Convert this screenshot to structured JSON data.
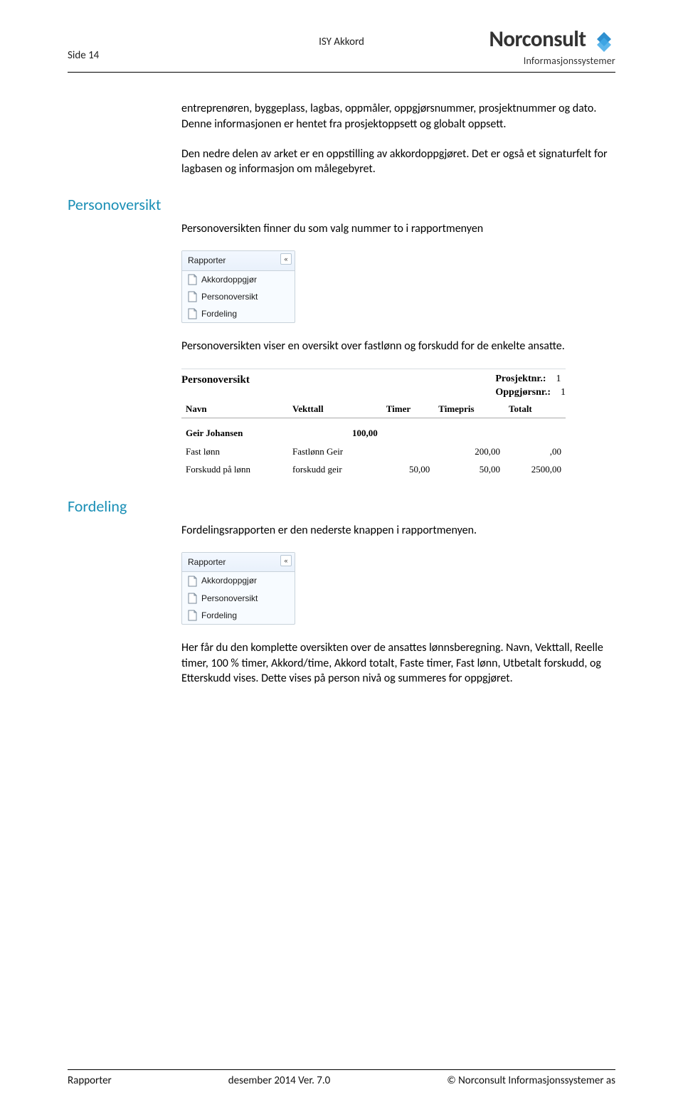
{
  "header": {
    "page_label": "Side 14",
    "app_title": "ISY Akkord"
  },
  "logo": {
    "brand": "Norconsult",
    "subtitle": "Informasjonssystemer"
  },
  "body": {
    "para1": "entreprenøren, byggeplass, lagbas, oppmåler, oppgjørsnummer, prosjektnummer og dato. Denne informasjonen er hentet fra prosjektoppsett og globalt oppsett.",
    "para2": "Den nedre delen av arket er en oppstilling av akkordoppgjøret. Det er også et signaturfelt for lagbasen og informasjon om målegebyret."
  },
  "panel": {
    "title": "Rapporter",
    "collapse_glyph": "«",
    "items": [
      "Akkordoppgjør",
      "Personoversikt",
      "Fordeling"
    ]
  },
  "sections": {
    "personoversikt": {
      "heading": "Personoversikt",
      "intro": "Personoversikten finner du som valg nummer to i rapportmenyen",
      "text2": "Personoversikten viser en oversikt over fastlønn og forskudd for de enkelte ansatte."
    },
    "fordeling": {
      "heading": "Fordeling",
      "intro": "Fordelingsrapporten er den nederste knappen i rapportmenyen.",
      "text2": "Her får du den komplette oversikten over de ansattes lønnsberegning. Navn, Vekttall, Reelle timer, 100 % timer, Akkord/time, Akkord totalt, Faste timer, Fast lønn, Utbetalt forskudd, og Etterskudd vises. Dette vises på person nivå og summeres for oppgjøret."
    }
  },
  "report": {
    "title": "Personoversikt",
    "meta": {
      "prosjekt_label": "Prosjektnr.:",
      "prosjekt_val": "1",
      "oppgjor_label": "Oppgjørsnr.:",
      "oppgjor_val": "1"
    },
    "columns": {
      "navn": "Navn",
      "vekttall": "Vekttall",
      "timer": "Timer",
      "timepris": "Timepris",
      "totalt": "Totalt"
    },
    "person": {
      "navn": "Geir Johansen",
      "vekttall": "100,00"
    },
    "rows": [
      {
        "label": "Fast lønn",
        "desc": "Fastlønn Geir",
        "timer": "",
        "timepris": "200,00",
        "totalt": ",00"
      },
      {
        "label": "Forskudd på lønn",
        "desc": "forskudd geir",
        "timer": "50,00",
        "timepris": "50,00",
        "totalt": "2500,00"
      }
    ]
  },
  "footer": {
    "left": "Rapporter",
    "center": "desember 2014 Ver. 7.0",
    "right": "© Norconsult Informasjonssystemer as"
  }
}
